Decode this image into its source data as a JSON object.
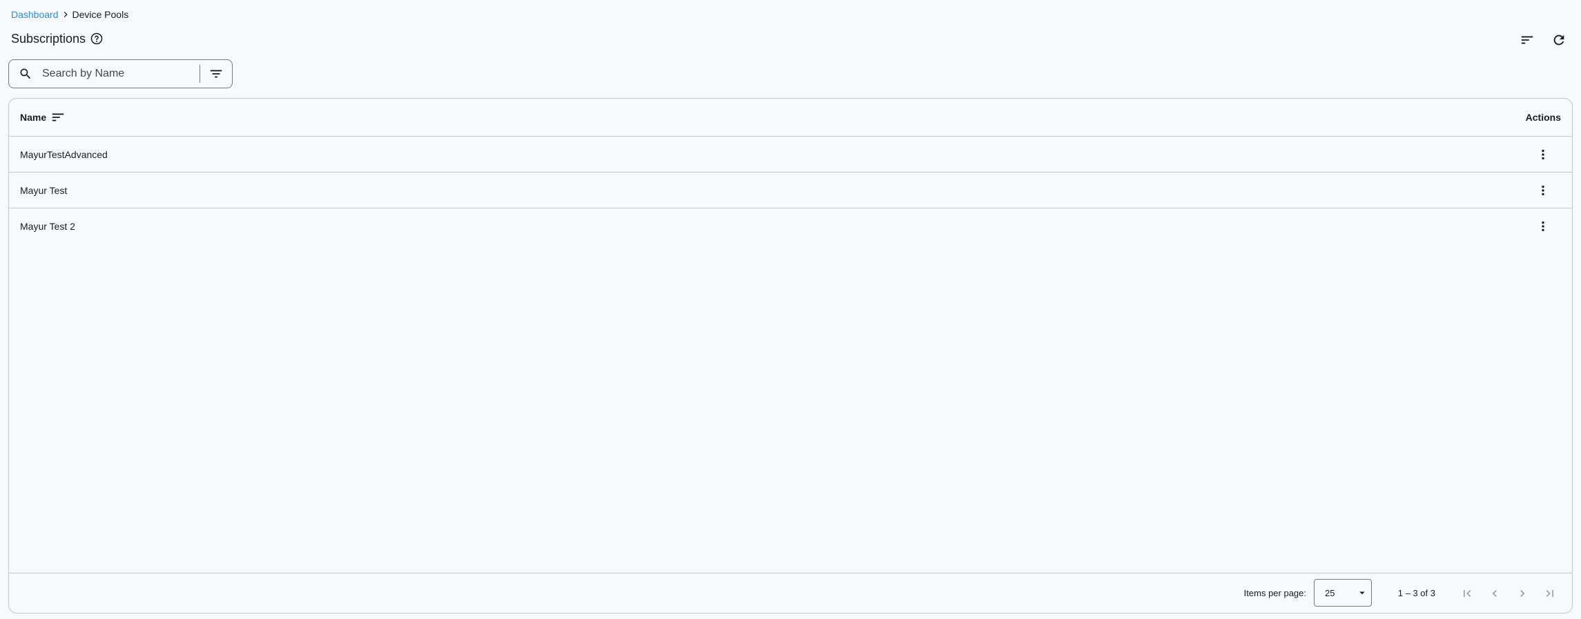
{
  "breadcrumb": {
    "link": "Dashboard",
    "current": "Device Pools"
  },
  "page": {
    "title": "Subscriptions"
  },
  "search": {
    "placeholder": "Search by Name",
    "value": ""
  },
  "table": {
    "columns": {
      "name": "Name",
      "actions": "Actions"
    },
    "rows": [
      {
        "name": "MayurTestAdvanced"
      },
      {
        "name": "Mayur Test"
      },
      {
        "name": "Mayur Test 2"
      }
    ]
  },
  "paginator": {
    "items_per_page_label": "Items per page:",
    "page_size": "25",
    "range_label": "1 – 3 of 3"
  },
  "colors": {
    "link": "#2b8fd6",
    "background": "#f8f9fd",
    "border": "#c4c6cf",
    "text": "#1b1b1f",
    "disabled_icon": "#9a9ca3"
  },
  "icons": {
    "breadcrumb_separator": "chevron-right-icon",
    "help": "help-circle-icon",
    "sort": "sort-icon",
    "refresh": "refresh-icon",
    "search": "search-icon",
    "filter": "filter-icon",
    "row_actions": "more-vert-icon",
    "dropdown": "arrow-drop-down-icon",
    "first_page": "first-page-icon",
    "prev_page": "chevron-left-icon",
    "next_page": "chevron-right-icon",
    "last_page": "last-page-icon"
  }
}
